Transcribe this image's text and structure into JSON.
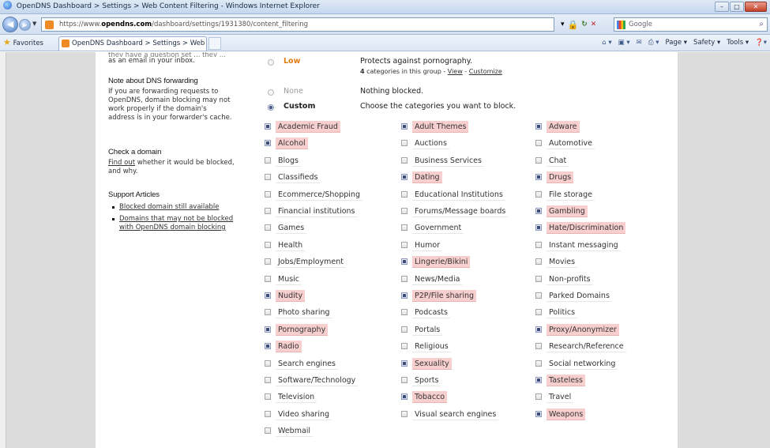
{
  "browser": {
    "window_title": "OpenDNS Dashboard > Settings > Web Content Filtering - Windows Internet Explorer",
    "url_prefix": "https://www.",
    "url_host": "opendns.com",
    "url_path": "/dashboard/settings/1931380/content_filtering",
    "search_placeholder": "Google",
    "favorites_label": "Favorites",
    "tab_title": "OpenDNS Dashboard > Settings > Web Content ...",
    "command_bar": [
      "Page ▾",
      "Safety ▾",
      "Tools ▾"
    ]
  },
  "sidebar": {
    "cut_top_text": "they have a question set ... they ...",
    "inbox_text": "as an email in your inbox.",
    "dns_forwarding": {
      "heading": "Note about DNS forwarding",
      "body": "If you are forwarding requests to OpenDNS, domain blocking may not work properly if the domain's address is in your forwarder's cache."
    },
    "check_domain": {
      "heading": "Check a domain",
      "link": "Find out",
      "body": " whether it would be blocked, and why."
    },
    "support": {
      "heading": "Support Articles",
      "articles": [
        "Blocked domain still available",
        "Domains that may not be blocked with OpenDNS domain blocking"
      ]
    }
  },
  "filter_levels": {
    "low": {
      "name": "Low",
      "desc": "Protects against pornography."
    },
    "low_sub": {
      "count": "4",
      "text": " categories in this group - ",
      "view": "View",
      "sep": " - ",
      "customize": "Customize"
    },
    "none": {
      "name": "None",
      "desc": "Nothing blocked."
    },
    "custom": {
      "name": "Custom",
      "desc": "Choose the categories you want to block."
    },
    "selected": "custom"
  },
  "categories": [
    {
      "name": "Academic Fraud",
      "blocked": true
    },
    {
      "name": "Adult Themes",
      "blocked": true
    },
    {
      "name": "Adware",
      "blocked": true
    },
    {
      "name": "Alcohol",
      "blocked": true
    },
    {
      "name": "Auctions",
      "blocked": false
    },
    {
      "name": "Automotive",
      "blocked": false
    },
    {
      "name": "Blogs",
      "blocked": false
    },
    {
      "name": "Business Services",
      "blocked": false
    },
    {
      "name": "Chat",
      "blocked": false
    },
    {
      "name": "Classifieds",
      "blocked": false
    },
    {
      "name": "Dating",
      "blocked": true
    },
    {
      "name": "Drugs",
      "blocked": true
    },
    {
      "name": "Ecommerce/Shopping",
      "blocked": false
    },
    {
      "name": "Educational Institutions",
      "blocked": false
    },
    {
      "name": "File storage",
      "blocked": false
    },
    {
      "name": "Financial institutions",
      "blocked": false
    },
    {
      "name": "Forums/Message boards",
      "blocked": false
    },
    {
      "name": "Gambling",
      "blocked": true
    },
    {
      "name": "Games",
      "blocked": false
    },
    {
      "name": "Government",
      "blocked": false
    },
    {
      "name": "Hate/Discrimination",
      "blocked": true
    },
    {
      "name": "Health",
      "blocked": false
    },
    {
      "name": "Humor",
      "blocked": false
    },
    {
      "name": "Instant messaging",
      "blocked": false
    },
    {
      "name": "Jobs/Employment",
      "blocked": false
    },
    {
      "name": "Lingerie/Bikini",
      "blocked": true
    },
    {
      "name": "Movies",
      "blocked": false
    },
    {
      "name": "Music",
      "blocked": false
    },
    {
      "name": "News/Media",
      "blocked": false
    },
    {
      "name": "Non-profits",
      "blocked": false
    },
    {
      "name": "Nudity",
      "blocked": true
    },
    {
      "name": "P2P/File sharing",
      "blocked": true
    },
    {
      "name": "Parked Domains",
      "blocked": false
    },
    {
      "name": "Photo sharing",
      "blocked": false
    },
    {
      "name": "Podcasts",
      "blocked": false
    },
    {
      "name": "Politics",
      "blocked": false
    },
    {
      "name": "Pornography",
      "blocked": true
    },
    {
      "name": "Portals",
      "blocked": false
    },
    {
      "name": "Proxy/Anonymizer",
      "blocked": true
    },
    {
      "name": "Radio",
      "blocked": true
    },
    {
      "name": "Religious",
      "blocked": false
    },
    {
      "name": "Research/Reference",
      "blocked": false
    },
    {
      "name": "Search engines",
      "blocked": false
    },
    {
      "name": "Sexuality",
      "blocked": true
    },
    {
      "name": "Social networking",
      "blocked": false
    },
    {
      "name": "Software/Technology",
      "blocked": false
    },
    {
      "name": "Sports",
      "blocked": false
    },
    {
      "name": "Tasteless",
      "blocked": true
    },
    {
      "name": "Television",
      "blocked": false
    },
    {
      "name": "Tobacco",
      "blocked": true
    },
    {
      "name": "Travel",
      "blocked": false
    },
    {
      "name": "Video sharing",
      "blocked": false
    },
    {
      "name": "Visual search engines",
      "blocked": false
    },
    {
      "name": "Weapons",
      "blocked": true
    },
    {
      "name": "Webmail",
      "blocked": false
    }
  ],
  "colors": {
    "blocked_highlight": "#f8cfcf",
    "low_level": "#e07a12"
  }
}
